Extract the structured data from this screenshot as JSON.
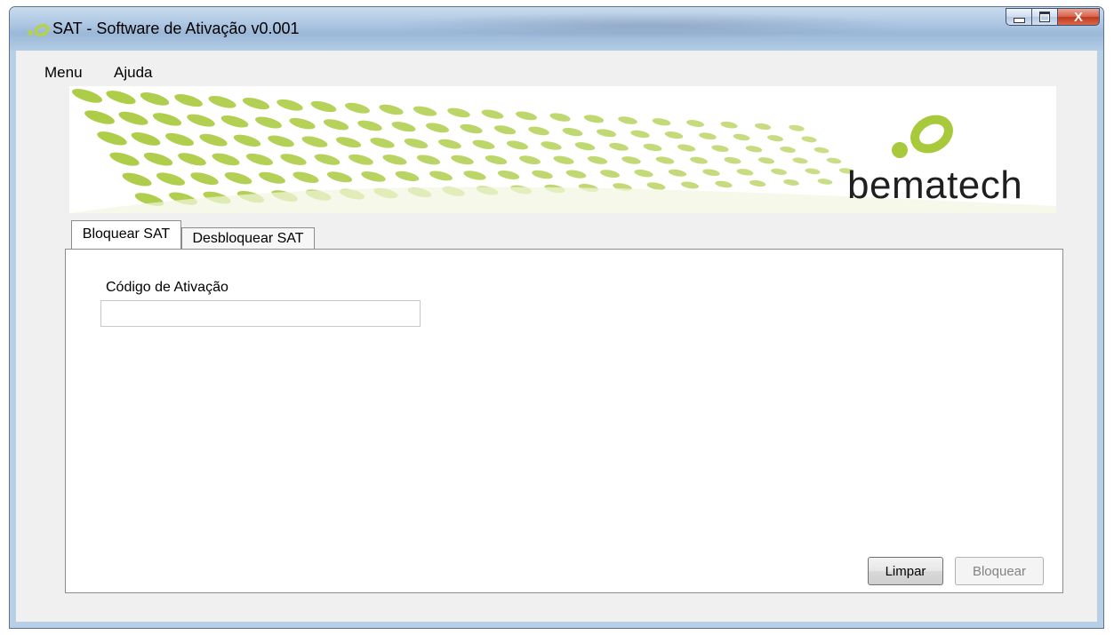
{
  "window": {
    "title": "SAT - Software de Ativação v0.001",
    "close_label": "X"
  },
  "menu": {
    "items": [
      "Menu",
      "Ajuda"
    ]
  },
  "banner": {
    "brand": "bematech",
    "accent_color": "#a8c93b"
  },
  "tabs": [
    {
      "label": "Bloquear SAT",
      "active": true
    },
    {
      "label": "Desbloquear SAT",
      "active": false
    }
  ],
  "form": {
    "activation_code_label": "Código de Ativação",
    "activation_code_value": ""
  },
  "buttons": {
    "clear_label": "Limpar",
    "block_label": "Bloquear"
  }
}
